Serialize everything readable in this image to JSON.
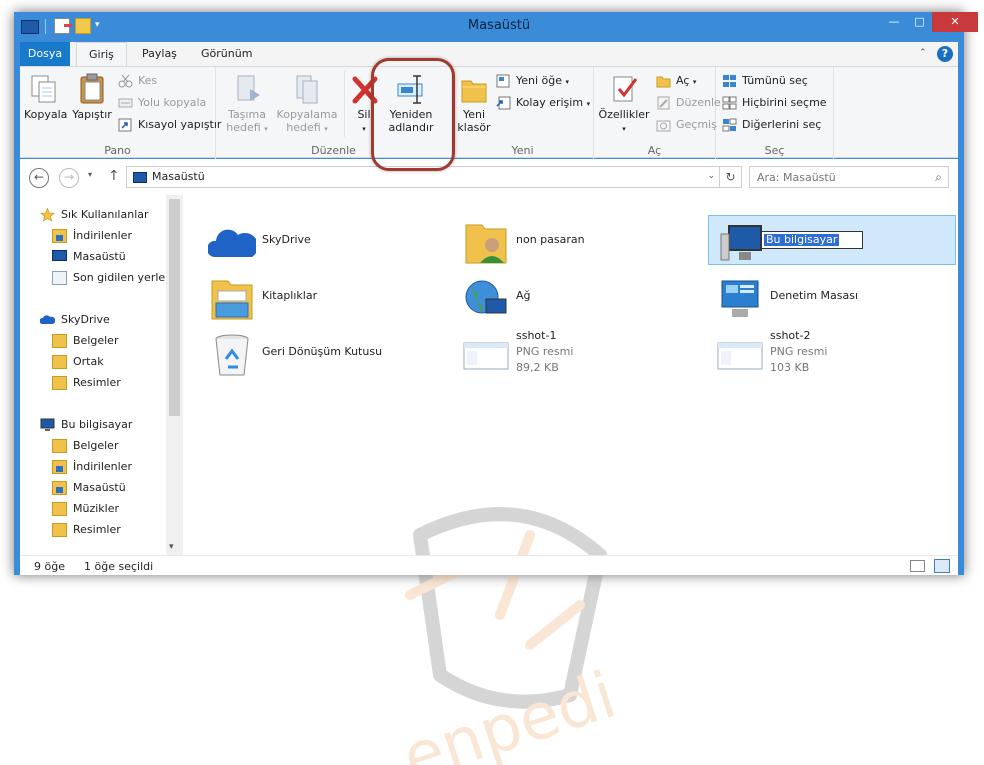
{
  "window": {
    "title": "Masaüstü"
  },
  "window_controls": {
    "minimize": "—",
    "maximize": "□",
    "close": "✕"
  },
  "quick_access": {
    "dropdown": "▾"
  },
  "tabs": {
    "file": "Dosya",
    "home": "Giriş",
    "share": "Paylaş",
    "view": "Görünüm"
  },
  "ribbon": {
    "collapse": "⌃",
    "help": "?",
    "groups": {
      "clipboard": {
        "label": "Pano",
        "copy": "Kopyala",
        "paste": "Yapıştır",
        "cut": "Kes",
        "copy_path": "Yolu kopyala",
        "paste_shortcut": "Kısayol yapıştır"
      },
      "organize": {
        "label": "Düzenle",
        "move_to_1": "Taşıma",
        "move_to_2": "hedefi",
        "copy_to_1": "Kopyalama",
        "copy_to_2": "hedefi",
        "delete": "Sil",
        "rename_1": "Yeniden",
        "rename_2": "adlandır"
      },
      "new": {
        "label": "Yeni",
        "new_folder_1": "Yeni",
        "new_folder_2": "klasör",
        "new_item": "Yeni öğe",
        "easy_access": "Kolay erişim"
      },
      "open": {
        "label": "Aç",
        "properties": "Özellikler",
        "open": "Aç",
        "edit": "Düzenle",
        "history": "Geçmiş"
      },
      "select": {
        "label": "Seç",
        "select_all": "Tümünü seç",
        "select_none": "Hiçbirini seçme",
        "invert": "Diğerlerini seç"
      }
    }
  },
  "navigation": {
    "back": "←",
    "forward": "→",
    "recent": "▾",
    "up": "↑",
    "address": "Masaüstü",
    "address_dropdown": "⌄",
    "refresh": "↻",
    "search_placeholder": "Ara: Masaüstü",
    "search_icon": "⌕"
  },
  "tree": {
    "favorites": "Sık Kullanılanlar",
    "downloads": "İndirilenler",
    "desktop": "Masaüstü",
    "recent": "Son gidilen yerler",
    "skydrive": "SkyDrive",
    "sky_docs": "Belgeler",
    "sky_shared": "Ortak",
    "sky_pics": "Resimler",
    "this_pc": "Bu bilgisayar",
    "pc_docs": "Belgeler",
    "pc_downloads": "İndirilenler",
    "pc_desktop": "Masaüstü",
    "pc_music": "Müzikler",
    "pc_pics": "Resimler"
  },
  "scroll_down": "▾",
  "items": {
    "skydrive": {
      "name": "SkyDrive"
    },
    "user": {
      "name": "non pasaran"
    },
    "this_pc": {
      "name": "Bu bilgisayar"
    },
    "libraries": {
      "name": "Kitaplıklar"
    },
    "network": {
      "name": "Ağ"
    },
    "control_panel": {
      "name": "Denetim Masası"
    },
    "recycle": {
      "name": "Geri Dönüşüm Kutusu"
    },
    "sshot1": {
      "name": "sshot-1",
      "type": "PNG resmi",
      "size": "89,2 KB"
    },
    "sshot2": {
      "name": "sshot-2",
      "type": "PNG resmi",
      "size": "103 KB"
    }
  },
  "watermark": {
    "text": "enpedi"
  },
  "status": {
    "count": "9 öğe",
    "selected": "1 öğe seçildi"
  }
}
